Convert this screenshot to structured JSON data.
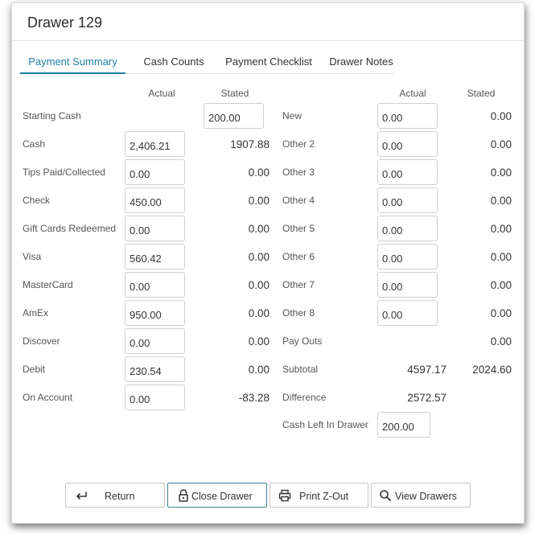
{
  "window": {
    "title": "Drawer 129"
  },
  "tabs": [
    {
      "label": "Payment Summary",
      "active": true
    },
    {
      "label": "Cash Counts",
      "active": false
    },
    {
      "label": "Payment Checklist",
      "active": false
    },
    {
      "label": "Drawer Notes",
      "active": false
    }
  ],
  "columns": {
    "actual": "Actual",
    "stated": "Stated"
  },
  "left": {
    "starting_cash": {
      "label": "Starting Cash",
      "stated": "200.00"
    },
    "rows": [
      {
        "label": "Cash",
        "actual": "2,406.21",
        "stated": "1907.88"
      },
      {
        "label": "Tips Paid/Collected",
        "actual": "0.00",
        "stated": "0.00"
      },
      {
        "label": "Check",
        "actual": "450.00",
        "stated": "0.00"
      },
      {
        "label": "Gift Cards Redeemed",
        "actual": "0.00",
        "stated": "0.00"
      },
      {
        "label": "Visa",
        "actual": "560.42",
        "stated": "0.00"
      },
      {
        "label": "MasterCard",
        "actual": "0.00",
        "stated": "0.00"
      },
      {
        "label": "AmEx",
        "actual": "950.00",
        "stated": "0.00"
      },
      {
        "label": "Discover",
        "actual": "0.00",
        "stated": "0.00"
      },
      {
        "label": "Debit",
        "actual": "230.54",
        "stated": "0.00"
      },
      {
        "label": "On Account",
        "actual": "0.00",
        "stated": "-83.28"
      }
    ]
  },
  "right": {
    "rows": [
      {
        "label": "New",
        "actual": "0.00",
        "stated": "0.00"
      },
      {
        "label": "Other 2",
        "actual": "0.00",
        "stated": "0.00"
      },
      {
        "label": "Other 3",
        "actual": "0.00",
        "stated": "0.00"
      },
      {
        "label": "Other 4",
        "actual": "0.00",
        "stated": "0.00"
      },
      {
        "label": "Other 5",
        "actual": "0.00",
        "stated": "0.00"
      },
      {
        "label": "Other 6",
        "actual": "0.00",
        "stated": "0.00"
      },
      {
        "label": "Other 7",
        "actual": "0.00",
        "stated": "0.00"
      },
      {
        "label": "Other 8",
        "actual": "0.00",
        "stated": "0.00"
      }
    ],
    "pay_outs": {
      "label": "Pay Outs",
      "stated": "0.00"
    },
    "subtotal": {
      "label": "Subtotal",
      "actual": "4597.17",
      "stated": "2024.60"
    },
    "difference": {
      "label": "Difference",
      "actual": "2572.57"
    },
    "cash_left": {
      "label": "Cash Left In Drawer",
      "value": "200.00"
    }
  },
  "buttons": {
    "return": {
      "label": "Return",
      "icon": "return-arrow-icon"
    },
    "close_drawer": {
      "label": "Close Drawer",
      "icon": "lock-icon"
    },
    "print_zout": {
      "label": "Print Z-Out",
      "icon": "printer-icon"
    },
    "view_drawers": {
      "label": "View Drawers",
      "icon": "search-icon"
    }
  },
  "colors": {
    "accent": "#1f7ea8",
    "primary_border": "#3f7f95"
  }
}
